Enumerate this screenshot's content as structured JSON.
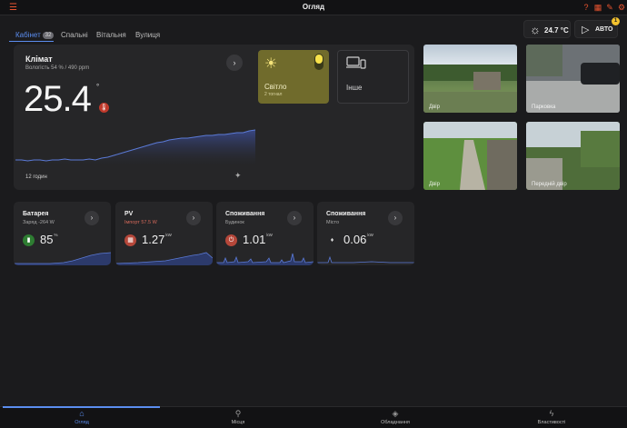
{
  "header": {
    "title": "Огляд"
  },
  "tabs": [
    {
      "label": "Кабінет",
      "badge": "32"
    },
    {
      "label": "Спальні"
    },
    {
      "label": "Вітальня"
    },
    {
      "label": "Вулиця"
    }
  ],
  "weather": {
    "temp": "24.7 °C"
  },
  "auto": {
    "label": "АВТО",
    "count": "1"
  },
  "climate": {
    "title": "Клімат",
    "subtitle": "Вологість 54 % / 490 ppm",
    "value": "25.4",
    "unit": "°",
    "period": "12 годин",
    "chart_data": {
      "type": "area",
      "values": [
        22.1,
        22.1,
        22.0,
        22.1,
        22.1,
        22.0,
        22.1,
        22.1,
        22.2,
        22.1,
        22.1,
        22.1,
        22.2,
        22.1,
        22.3,
        22.4,
        22.6,
        22.8,
        23.0,
        23.2,
        23.4,
        23.6,
        23.8,
        24.0,
        24.1,
        24.3,
        24.4,
        24.5,
        24.5,
        24.6,
        24.7,
        24.8,
        24.8,
        24.9,
        24.9,
        25.0,
        25.1,
        25.1,
        25.3,
        25.4
      ],
      "ylim": [
        21.5,
        26
      ]
    }
  },
  "light": {
    "name": "Світло",
    "status": "2 тогнал"
  },
  "other": {
    "name": "Інше"
  },
  "cameras": [
    {
      "label": "Двір"
    },
    {
      "label": "Парковка"
    },
    {
      "label": "Двір"
    },
    {
      "label": "Передній двір"
    }
  ],
  "sensors": [
    {
      "name": "Батарея",
      "sub": "Заряд -264 W",
      "value": "85",
      "unit": "%",
      "color": "#2e7d32",
      "icon": "battery-icon"
    },
    {
      "name": "PV",
      "sub": "Імпорт 57.5 W",
      "value": "1.27",
      "unit": "kW",
      "color": "#b5473a",
      "icon": "solar-panel-icon"
    },
    {
      "name": "Споживання",
      "sub": "Будинок",
      "value": "1.01",
      "unit": "kW",
      "color": "#b5473a",
      "icon": "plug-icon"
    },
    {
      "name": "Споживання",
      "sub": "Місто",
      "value": "0.06",
      "unit": "kW",
      "color": "#444",
      "icon": "grid-icon"
    }
  ],
  "nav": [
    {
      "label": "Огляд"
    },
    {
      "label": "Місця"
    },
    {
      "label": "Обладнання"
    },
    {
      "label": "Властивості"
    }
  ]
}
